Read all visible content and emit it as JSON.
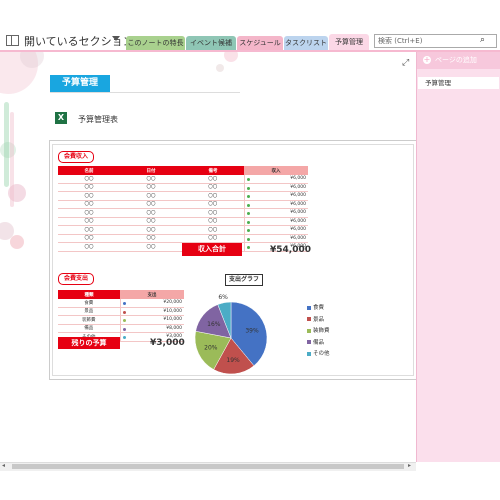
{
  "notebook": {
    "title": "開いているセクション"
  },
  "tabs": [
    {
      "label": "このノートの特長",
      "color": "#a9d18e"
    },
    {
      "label": "イベント候補",
      "color": "#8fc6b5"
    },
    {
      "label": "スケジュール",
      "color": "#f4b6c9"
    },
    {
      "label": "タスクリスト",
      "color": "#bcd4ee"
    },
    {
      "label": "予算管理",
      "color": "#fbd8e6",
      "active": true
    }
  ],
  "search": {
    "placeholder": "検索 (Ctrl+E)"
  },
  "page": {
    "title": "予算管理",
    "attachment": "予算管理表"
  },
  "income": {
    "label": "会費収入",
    "headers": [
      "名前",
      "日付",
      "備考",
      "収入"
    ],
    "rows": [
      [
        "〇〇",
        "〇〇",
        "〇〇",
        "¥6,000"
      ],
      [
        "〇〇",
        "〇〇",
        "〇〇",
        "¥6,000"
      ],
      [
        "〇〇",
        "〇〇",
        "〇〇",
        "¥6,000"
      ],
      [
        "〇〇",
        "〇〇",
        "〇〇",
        "¥6,000"
      ],
      [
        "〇〇",
        "〇〇",
        "〇〇",
        "¥6,000"
      ],
      [
        "〇〇",
        "〇〇",
        "〇〇",
        "¥6,000"
      ],
      [
        "〇〇",
        "〇〇",
        "〇〇",
        "¥6,000"
      ],
      [
        "〇〇",
        "〇〇",
        "〇〇",
        "¥6,000"
      ],
      [
        "〇〇",
        "〇〇",
        "〇〇",
        "¥6,000"
      ]
    ],
    "total_label": "収入合計",
    "total_value": "¥54,000"
  },
  "expense": {
    "label": "会費支出",
    "headers": [
      "種類",
      "支出"
    ],
    "rows": [
      [
        "食費",
        "¥20,000",
        "#4472c4"
      ],
      [
        "景品",
        "¥10,000",
        "#c0504d"
      ],
      [
        "装飾費",
        "¥10,000",
        "#9bbb59"
      ],
      [
        "備品",
        "¥8,000",
        "#8064a2"
      ],
      [
        "その他",
        "¥3,000",
        "#4bacc6"
      ]
    ],
    "remaining_label": "残りの予算",
    "remaining_value": "¥3,000"
  },
  "chart_data": {
    "type": "pie",
    "title": "支出グラフ",
    "categories": [
      "食費",
      "景品",
      "装飾費",
      "備品",
      "その他"
    ],
    "values": [
      39,
      19,
      20,
      16,
      6
    ],
    "labels": [
      "39%",
      "19%",
      "20%",
      "16%",
      "6%"
    ],
    "colors": [
      "#4472c4",
      "#c0504d",
      "#9bbb59",
      "#8064a2",
      "#4bacc6"
    ],
    "legend": "right"
  },
  "sidebar": {
    "add_page": "ページの追加",
    "pages": [
      "予算管理"
    ]
  }
}
